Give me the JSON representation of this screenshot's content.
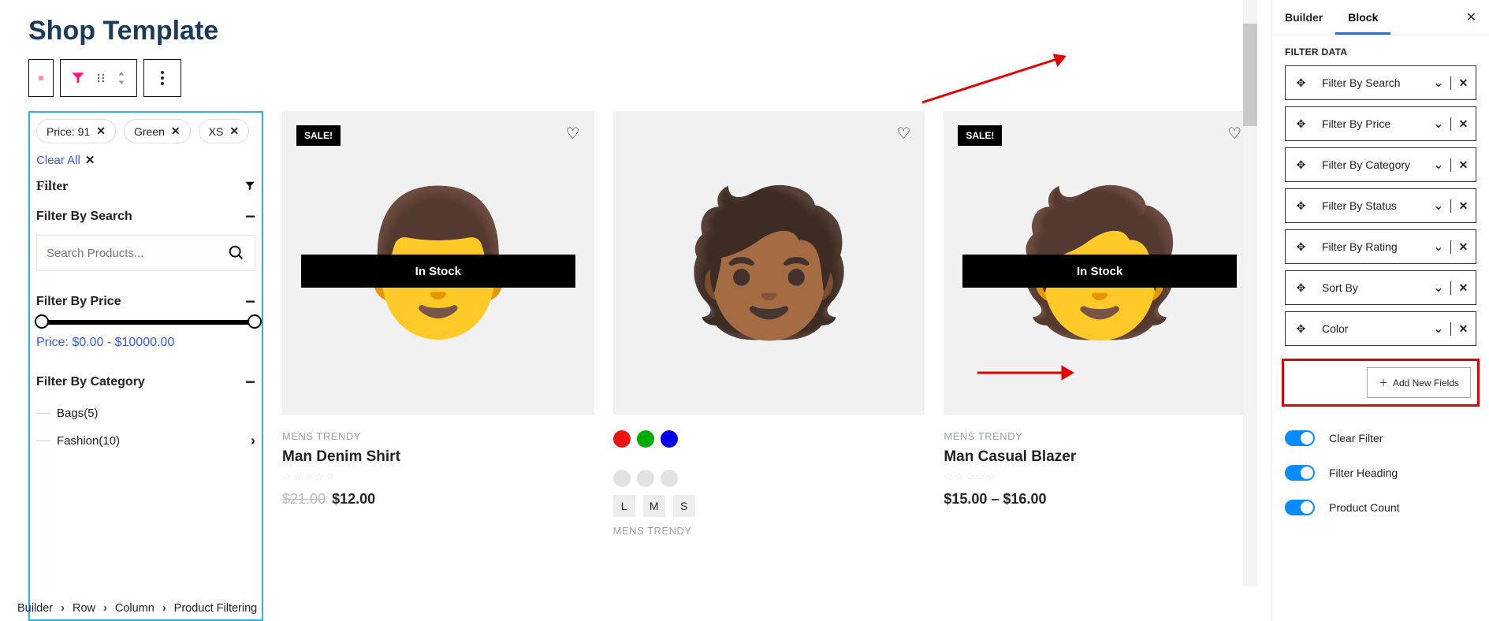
{
  "page": {
    "title": "Shop Template"
  },
  "activeFilters": {
    "chips": [
      "Price: 91",
      "Green",
      "XS"
    ],
    "clear": "Clear All"
  },
  "filterPanel": {
    "heading": "Filter",
    "search": {
      "title": "Filter By Search",
      "placeholder": "Search Products..."
    },
    "price": {
      "title": "Filter By Price",
      "text": "Price: $0.00 - $10000.00"
    },
    "category": {
      "title": "Filter By Category",
      "items": [
        {
          "label": "Bags(5)",
          "expandable": false
        },
        {
          "label": "Fashion(10)",
          "expandable": true
        }
      ]
    }
  },
  "products": [
    {
      "sale": true,
      "inStock": "In Stock",
      "cats": "MENS  TRENDY",
      "title": "Man Denim Shirt",
      "oldPrice": "$21.00",
      "price": "$12.00",
      "stars": "☆☆☆☆☆",
      "swatches": [],
      "sizes": []
    },
    {
      "sale": false,
      "inStock": "",
      "cats": "MENS  TRENDY",
      "title": "",
      "oldPrice": "",
      "price": "",
      "stars": "",
      "swatchColors": [
        "#e11",
        "#0a0",
        "#00e"
      ],
      "greySwatches": 3,
      "sizes": [
        "L",
        "M",
        "S"
      ]
    },
    {
      "sale": true,
      "inStock": "In Stock",
      "cats": "MENS  TRENDY",
      "title": "Man Casual Blazer",
      "oldPrice": "",
      "price": "$15.00 – $16.00",
      "stars": "☆☆☆☆☆",
      "swatches": [],
      "sizes": []
    }
  ],
  "sidebar": {
    "tabs": [
      "Builder",
      "Block"
    ],
    "activeTab": 1,
    "sectionTitle": "FILTER DATA",
    "items": [
      "Filter By Search",
      "Filter By Price",
      "Filter By Category",
      "Filter By Status",
      "Filter By Rating",
      "Sort By",
      "Color"
    ],
    "addNew": "Add New Fields",
    "toggles": [
      "Clear Filter",
      "Filter Heading",
      "Product Count"
    ]
  },
  "breadcrumb": [
    "Builder",
    "Row",
    "Column",
    "Product Filtering"
  ]
}
